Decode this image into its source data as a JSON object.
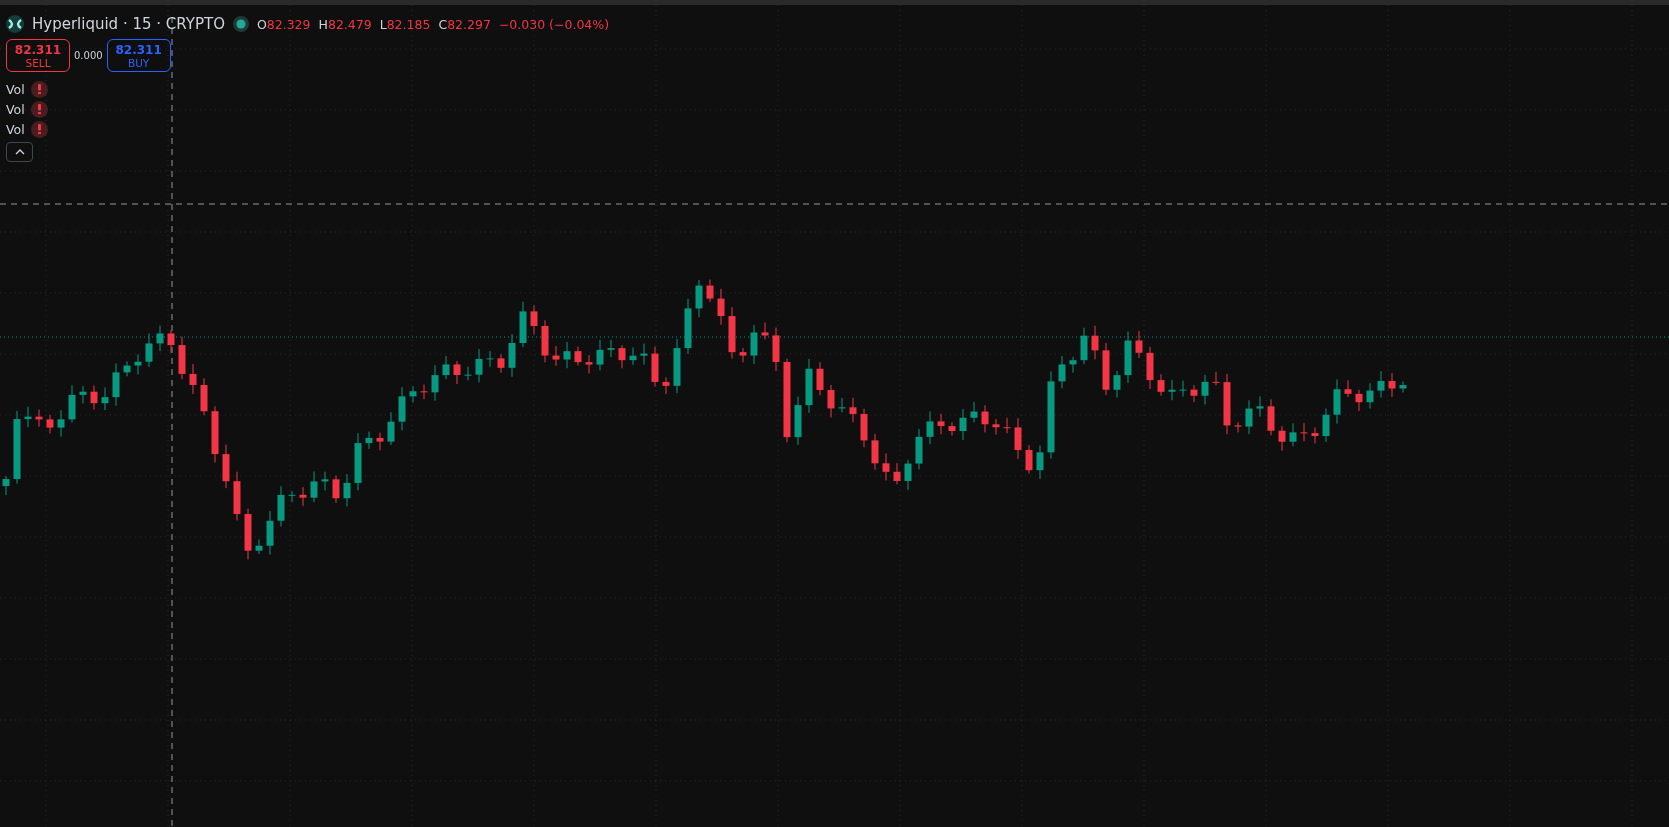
{
  "legend": {
    "title": "Hyperliquid · 15 · CRYPTO",
    "ohlc": [
      {
        "label": "O",
        "value": "82.329"
      },
      {
        "label": "H",
        "value": "82.479"
      },
      {
        "label": "L",
        "value": "82.185"
      },
      {
        "label": "C",
        "value": "82.297"
      }
    ],
    "change": "−0.030 (−0.04%)"
  },
  "trade": {
    "sell": {
      "price": "82.311",
      "label": "SELL"
    },
    "spread": "0.000",
    "buy": {
      "price": "82.311",
      "label": "BUY"
    }
  },
  "indicators": [
    {
      "name": "Vol",
      "error": true
    },
    {
      "name": "Vol",
      "error": true
    },
    {
      "name": "Vol",
      "error": true
    }
  ],
  "legend_expanded": true
}
